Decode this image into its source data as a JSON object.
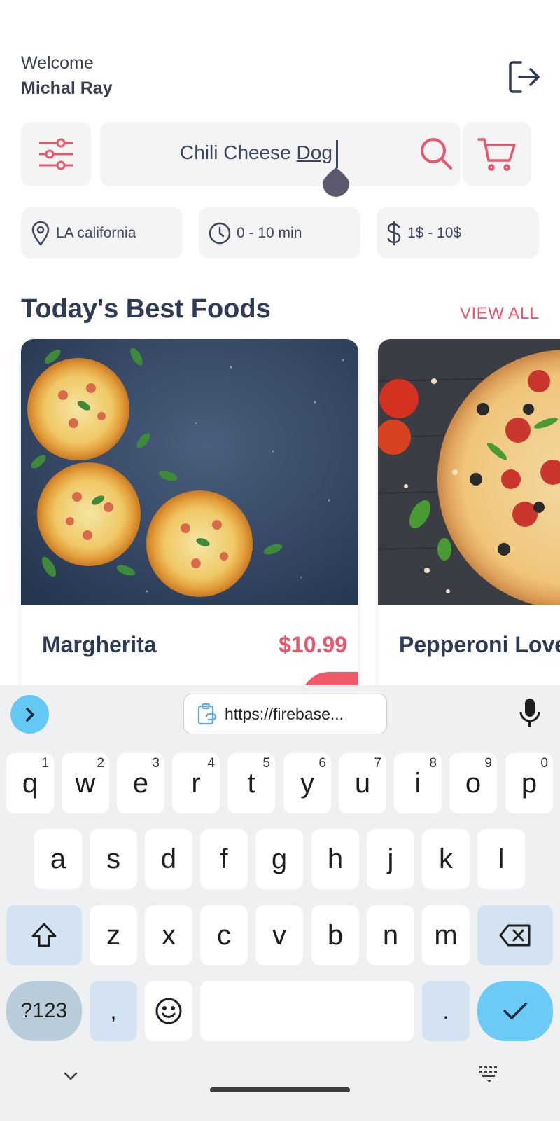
{
  "header": {
    "greeting": "Welcome",
    "user_name": "Michal Ray",
    "logout_icon": "logout-icon"
  },
  "search": {
    "query_prefix": "Chili Cheese ",
    "query_suffix": "Dog",
    "filter_icon": "sliders-icon",
    "search_icon": "search-icon",
    "cart_icon": "cart-icon"
  },
  "chips": [
    {
      "icon": "location-pin-icon",
      "label": "LA california"
    },
    {
      "icon": "clock-icon",
      "label": "0 - 10 min"
    },
    {
      "icon": "dollar-icon",
      "label": "1$ - 10$"
    }
  ],
  "section": {
    "title": "Today's Best Foods",
    "view_all": "VIEW ALL"
  },
  "foods": [
    {
      "name": "Margherita",
      "price": "$10.99"
    },
    {
      "name": "Pepperoni Lovers",
      "price": ""
    }
  ],
  "colors": {
    "accent": "#e8576b",
    "text_dark": "#2f3a55",
    "chip_bg": "#f4f4f5",
    "keyboard_bg": "#eff0f2",
    "keyboard_accent": "#6ccaf7"
  },
  "keyboard": {
    "clipboard_suggestion": "https://firebase...",
    "row1": [
      {
        "key": "q",
        "num": "1"
      },
      {
        "key": "w",
        "num": "2"
      },
      {
        "key": "e",
        "num": "3"
      },
      {
        "key": "r",
        "num": "4"
      },
      {
        "key": "t",
        "num": "5"
      },
      {
        "key": "y",
        "num": "6"
      },
      {
        "key": "u",
        "num": "7"
      },
      {
        "key": "i",
        "num": "8"
      },
      {
        "key": "o",
        "num": "9"
      },
      {
        "key": "p",
        "num": "0"
      }
    ],
    "row2": [
      "a",
      "s",
      "d",
      "f",
      "g",
      "h",
      "j",
      "k",
      "l"
    ],
    "row3": [
      "z",
      "x",
      "c",
      "v",
      "b",
      "n",
      "m"
    ],
    "symbols_label": "?123",
    "comma": ",",
    "period": "."
  }
}
